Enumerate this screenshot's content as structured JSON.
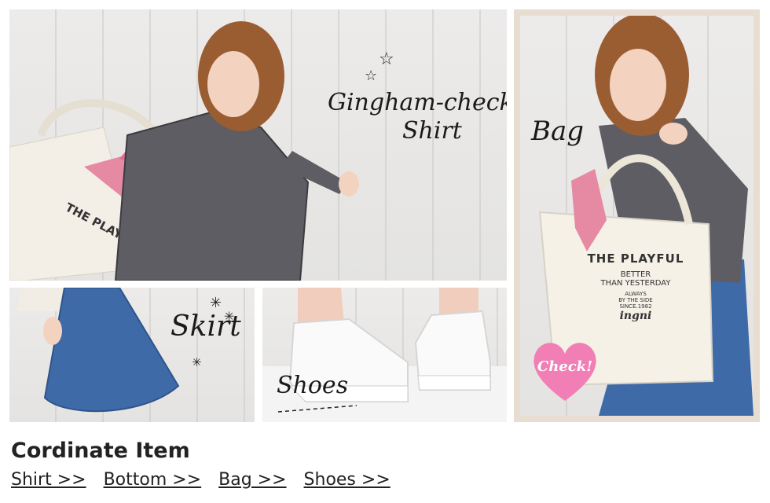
{
  "photos": {
    "shirt": {
      "caption_line1": "Gingham-check",
      "caption_line2": "Shirt"
    },
    "skirt": {
      "caption": "Skirt"
    },
    "shoes": {
      "caption": "Shoes"
    },
    "bag": {
      "caption": "Bag",
      "badge": "Check!",
      "tote_print": [
        "THE PLAYFUL",
        "BETTER",
        "THAN YESTERDAY",
        "ALWAYS",
        "BY THE SIDE",
        "SINCE.1982",
        "ingni"
      ]
    }
  },
  "section": {
    "title": "Cordinate Item",
    "links": [
      "Shirt >>",
      "Bottom >>",
      "Bag >>",
      "Shoes >>"
    ]
  },
  "colors": {
    "badge_pink": "#f17fb5",
    "denim": "#3e6aa8",
    "frame": "#e7ddd1"
  }
}
